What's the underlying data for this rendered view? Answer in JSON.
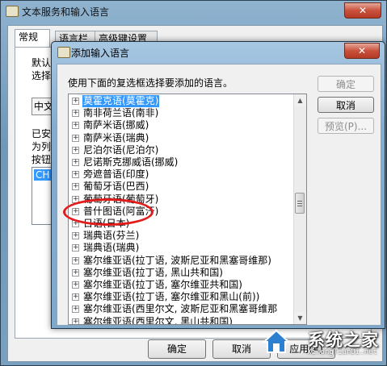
{
  "back_window": {
    "title": "文本服务和输入语言",
    "close_glyph": "✕",
    "tabs": [
      "常规",
      "语言栏",
      "高级键设置"
    ],
    "fragments": {
      "default_1": "默认",
      "default_2": "选择",
      "dropdown_value": "中文",
      "installed_1": "已安",
      "installed_2": "为列",
      "installed_3": "按钮",
      "lang_item": "CH"
    },
    "buttons": {
      "ok": "确定",
      "cancel": "取消",
      "apply": "应用(A)"
    }
  },
  "dialog": {
    "title": "添加输入语言",
    "close_glyph": "✕",
    "instruction": "使用下面的复选框选择要添加的语言。",
    "languages": [
      {
        "label": "莫霍克语(莫霍克)",
        "selected": true
      },
      {
        "label": "南非荷兰语(南非)",
        "selected": false
      },
      {
        "label": "南萨米语(挪威)",
        "selected": false
      },
      {
        "label": "南萨米语(瑞典)",
        "selected": false
      },
      {
        "label": "尼泊尔语(尼泊尔)",
        "selected": false
      },
      {
        "label": "尼诺斯克挪威语(挪威)",
        "selected": false
      },
      {
        "label": "旁遮普语(印度)",
        "selected": false
      },
      {
        "label": "葡萄牙语(巴西)",
        "selected": false
      },
      {
        "label": "葡萄牙语(葡萄牙)",
        "selected": false
      },
      {
        "label": "普什图语(阿富汗)",
        "selected": false
      },
      {
        "label": "日语(日本)",
        "selected": false
      },
      {
        "label": "瑞典语(芬兰)",
        "selected": false
      },
      {
        "label": "瑞典语(瑞典)",
        "selected": false
      },
      {
        "label": "塞尔维亚语(拉丁语, 波斯尼亚和黑塞哥维那)",
        "selected": false
      },
      {
        "label": "塞尔维亚语(拉丁语, 黑山共和国)",
        "selected": false
      },
      {
        "label": "塞尔维亚语(拉丁语, 塞尔维亚共和国)",
        "selected": false
      },
      {
        "label": "塞尔维亚语(拉丁语, 塞尔维亚和黑山(前))",
        "selected": false
      },
      {
        "label": "塞尔维亚语(西里尔文, 波斯尼亚和黑塞哥维那",
        "selected": false
      },
      {
        "label": "塞尔维亚语(西里尔文, 黑山共和国)",
        "selected": false
      }
    ],
    "buttons": {
      "ok": "确定",
      "cancel": "取消",
      "preview": "预览(P)..."
    },
    "expander_glyph": "+",
    "scroll_up_glyph": "▲",
    "scroll_down_glyph": "▼"
  },
  "watermark": {
    "brand": "系统之家",
    "url": "XiTongTianDi.net"
  },
  "colors": {
    "selection": "#3399ff",
    "highlight_ring": "#e21b1b",
    "titlebar": "#84acd0"
  }
}
